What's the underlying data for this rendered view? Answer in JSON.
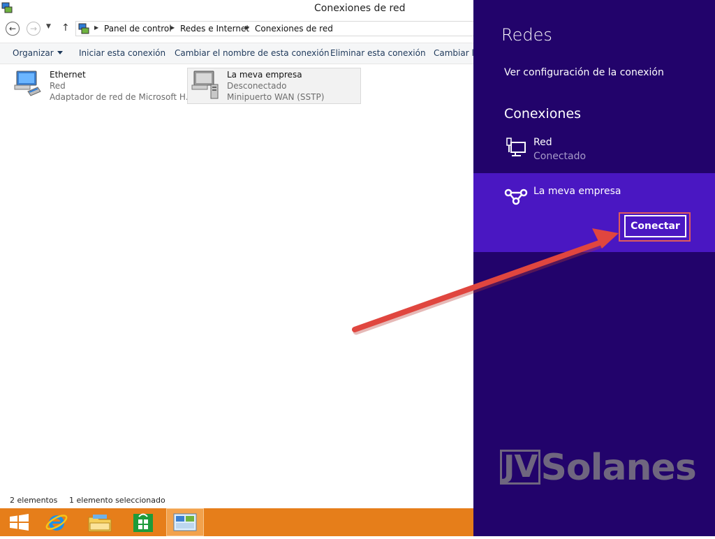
{
  "window": {
    "title": "Conexiones de red"
  },
  "addressbar": {
    "crumbs": [
      "Panel de control",
      "Redes e Internet",
      "Conexiones de red"
    ]
  },
  "toolbar": {
    "organize": "Organizar",
    "start_connection": "Iniciar esta conexión",
    "rename_connection": "Cambiar el nombre de esta conexión",
    "delete_connection": "Eliminar esta conexión",
    "change_settings": "Cambiar la"
  },
  "connections": [
    {
      "name": "Ethernet",
      "status": "Red",
      "device": "Adaptador de red de Microsoft H..."
    },
    {
      "name": "La meva empresa",
      "status": "Desconectado",
      "device": "Minipuerto WAN (SSTP)"
    }
  ],
  "statusbar": {
    "count": "2 elementos",
    "selected": "1 elemento seleccionado"
  },
  "charm": {
    "title": "Redes",
    "view_settings": "Ver configuración de la conexión",
    "connections_heading": "Conexiones",
    "networks": [
      {
        "name": "Red",
        "status": "Conectado"
      },
      {
        "name": "La meva empresa"
      }
    ],
    "connect_label": "Conectar"
  },
  "logo": {
    "jv": "JV",
    "rest": "Solanes"
  },
  "colors": {
    "charm_bg": "#22036b",
    "selected_bg": "#4a17c2",
    "taskbar": "#e67e1a",
    "annotation_arrow": "#e0463f"
  },
  "taskbar": {
    "icons": [
      "windows-start-icon",
      "internet-explorer-icon",
      "file-explorer-icon",
      "store-icon",
      "network-connections-icon"
    ]
  }
}
